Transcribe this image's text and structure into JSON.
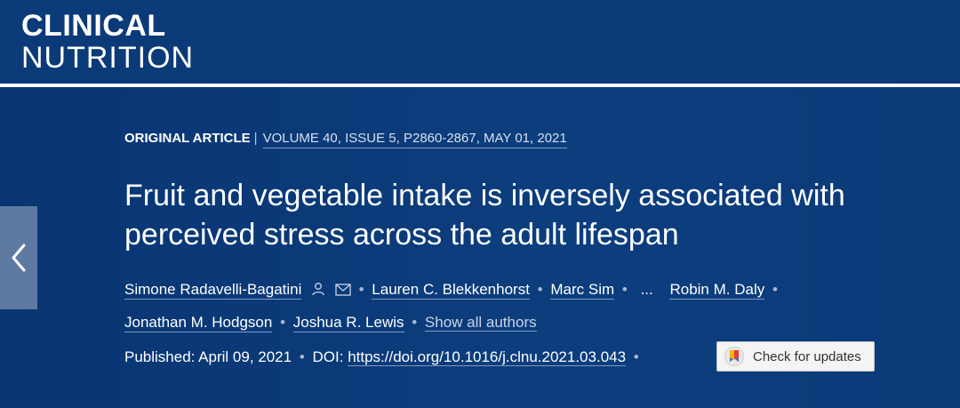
{
  "journal": {
    "line1": "CLINICAL",
    "line2": "NUTRITION"
  },
  "meta": {
    "type": "ORIGINAL ARTICLE",
    "separator": "|",
    "volume": "VOLUME 40, ISSUE 5, P2860-2867, MAY 01, 2021"
  },
  "article": {
    "title": "Fruit and vegetable intake is inversely associated with perceived stress across the adult lifespan"
  },
  "authors": {
    "list": [
      "Simone Radavelli-Bagatini",
      "Lauren C. Blekkenhorst",
      "Marc Sim",
      "Robin M. Daly",
      "Jonathan M. Hodgson",
      "Joshua R. Lewis"
    ],
    "ellipsis": "...",
    "show_all": "Show all authors",
    "bullet": "•"
  },
  "publication": {
    "published": "Published: April 09, 2021",
    "doi_label": "DOI:",
    "doi": "https://doi.org/10.1016/j.clnu.2021.03.043",
    "bullet": "•"
  },
  "check_updates": {
    "label": "Check for updates",
    "icon": "crossmark-icon"
  },
  "icons": {
    "prev": "chevron-left-icon",
    "person": "person-icon",
    "email": "email-icon"
  },
  "colors": {
    "background": "#0b3a78",
    "accent": "#5e7aa1"
  }
}
